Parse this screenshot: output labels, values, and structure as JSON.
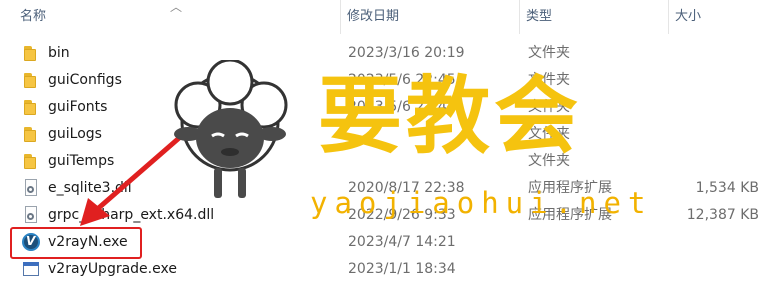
{
  "columns": {
    "name": "名称",
    "date": "修改日期",
    "type": "类型",
    "size": "大小"
  },
  "files": [
    {
      "name": "bin",
      "date": "2023/3/16 20:19",
      "type": "文件夹",
      "size": "",
      "icon": "folder-icon"
    },
    {
      "name": "guiConfigs",
      "date": "2023/5/6 22:45",
      "type": "文件夹",
      "size": "",
      "icon": "folder-icon"
    },
    {
      "name": "guiFonts",
      "date": "2023/5/6 22:44",
      "type": "文件夹",
      "size": "",
      "icon": "folder-icon"
    },
    {
      "name": "guiLogs",
      "date": "",
      "type": "文件夹",
      "size": "",
      "icon": "folder-icon"
    },
    {
      "name": "guiTemps",
      "date": "",
      "type": "文件夹",
      "size": "",
      "icon": "folder-icon"
    },
    {
      "name": "e_sqlite3.dll",
      "date": "2020/8/17 22:38",
      "type": "应用程序扩展",
      "size": "1,534 KB",
      "icon": "dll-file-icon"
    },
    {
      "name": "grpc_csharp_ext.x64.dll",
      "date": "2022/9/26 9:33",
      "type": "应用程序扩展",
      "size": "12,387 KB",
      "icon": "dll-file-icon"
    },
    {
      "name": "v2rayN.exe",
      "date": "2023/4/7 14:21",
      "type": "",
      "size": "",
      "icon": "v2ray-app-icon"
    },
    {
      "name": "v2rayUpgrade.exe",
      "date": "2023/1/1 18:34",
      "type": "",
      "size": "",
      "icon": "window-app-icon"
    }
  ],
  "watermark": {
    "title": "要教会",
    "url": "yaojiaohui.net"
  },
  "colors": {
    "accent_red": "#e02020",
    "watermark_yellow": "#f5c30f",
    "folder_yellow": "#f6c543"
  }
}
